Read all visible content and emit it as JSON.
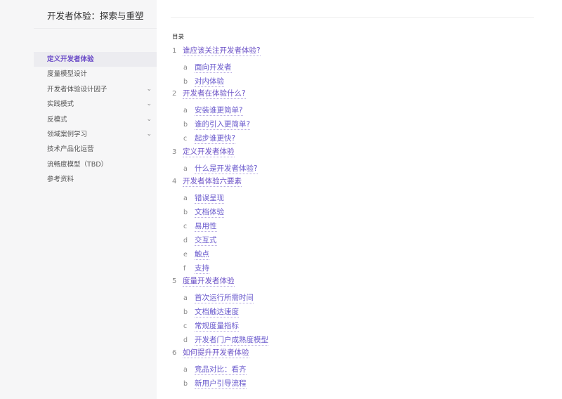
{
  "sidebar": {
    "title": "开发者体验：探索与重塑",
    "items": [
      {
        "label": "定义开发者体验",
        "active": true,
        "chevron": false
      },
      {
        "label": "度量模型设计",
        "active": false,
        "chevron": false
      },
      {
        "label": "开发者体验设计因子",
        "active": false,
        "chevron": true
      },
      {
        "label": "实践模式",
        "active": false,
        "chevron": true
      },
      {
        "label": "反模式",
        "active": false,
        "chevron": true
      },
      {
        "label": "领域案例学习",
        "active": false,
        "chevron": true
      },
      {
        "label": "技术产品化运营",
        "active": false,
        "chevron": false
      },
      {
        "label": "流畅度模型（TBD）",
        "active": false,
        "chevron": false
      },
      {
        "label": "参考资料",
        "active": false,
        "chevron": false
      }
    ],
    "chevron_icon": "chevron-down-icon"
  },
  "toc": {
    "label": "目录",
    "sections": [
      {
        "num": "1",
        "title": "谁应该关注开发者体验?",
        "items": [
          {
            "letter": "a",
            "title": "面向开发者"
          },
          {
            "letter": "b",
            "title": "对内体验"
          }
        ]
      },
      {
        "num": "2",
        "title": "开发者在体验什么?",
        "items": [
          {
            "letter": "a",
            "title": "安装谁更简单?"
          },
          {
            "letter": "b",
            "title": "谁的引入更简单?"
          },
          {
            "letter": "c",
            "title": "起步谁更快?"
          }
        ]
      },
      {
        "num": "3",
        "title": "定义开发者体验",
        "items": [
          {
            "letter": "a",
            "title": "什么是开发者体验?"
          }
        ]
      },
      {
        "num": "4",
        "title": "开发者体验六要素",
        "items": [
          {
            "letter": "a",
            "title": "错误呈现"
          },
          {
            "letter": "b",
            "title": "文档体验"
          },
          {
            "letter": "c",
            "title": "易用性"
          },
          {
            "letter": "d",
            "title": "交互式"
          },
          {
            "letter": "e",
            "title": "触点"
          },
          {
            "letter": "f",
            "title": "支持"
          }
        ]
      },
      {
        "num": "5",
        "title": "度量开发者体验",
        "items": [
          {
            "letter": "a",
            "title": "首次运行所需时间"
          },
          {
            "letter": "b",
            "title": "文档触达速度"
          },
          {
            "letter": "c",
            "title": "常规度量指标"
          },
          {
            "letter": "d",
            "title": "开发者门户成熟度模型"
          }
        ]
      },
      {
        "num": "6",
        "title": "如何提升开发者体验",
        "items": [
          {
            "letter": "a",
            "title": "竞品对比：看齐"
          },
          {
            "letter": "b",
            "title": "新用户引导流程"
          }
        ]
      }
    ]
  },
  "colors": {
    "accent": "#6a4fc6",
    "sidebar_bg": "#f6f6f7",
    "active_bg": "#ececf0"
  }
}
